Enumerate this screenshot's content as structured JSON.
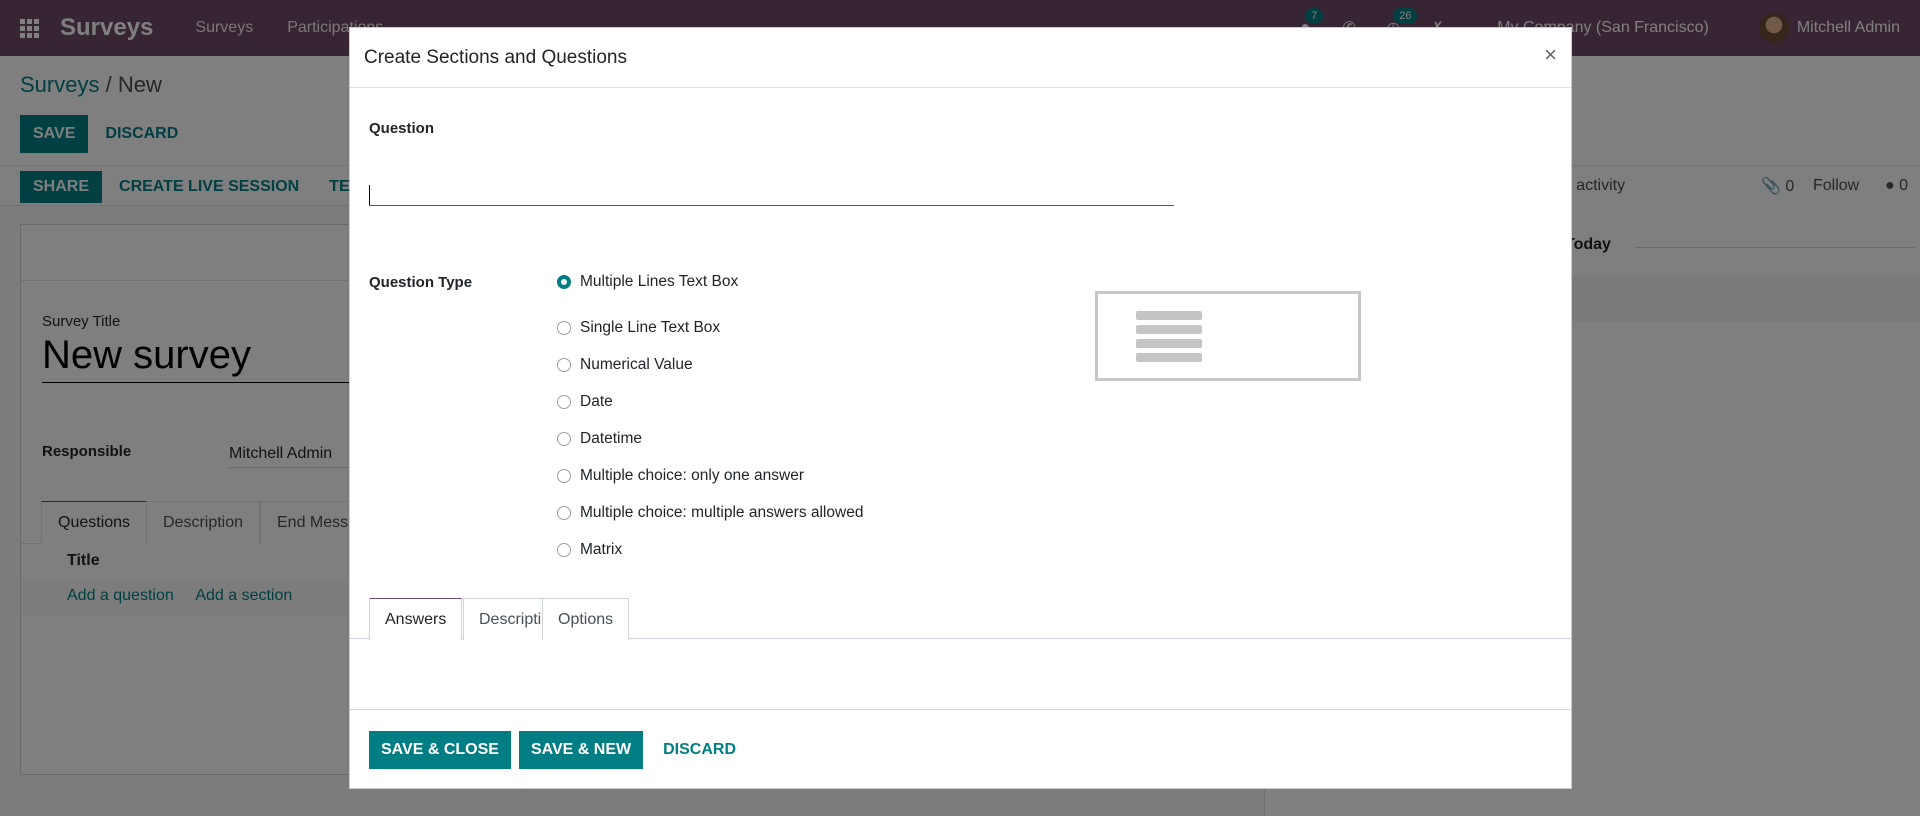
{
  "navbar": {
    "app_name": "Surveys",
    "menus": [
      "Surveys",
      "Participations"
    ],
    "messages_count": "7",
    "activities_count": "26",
    "company": "My Company (San Francisco)",
    "user": "Mitchell Admin"
  },
  "breadcrumb": {
    "parent": "Surveys",
    "separator": "/",
    "current": "New"
  },
  "control_panel": {
    "save": "Save",
    "discard": "Discard"
  },
  "statusbar": {
    "share": "Share",
    "create_live_session": "Create Live Session",
    "test": "Test"
  },
  "form": {
    "survey_title_label": "Survey Title",
    "survey_title_value": "New survey",
    "responsible_label": "Responsible",
    "responsible_value": "Mitchell Admin",
    "tabs": [
      "Questions",
      "Description",
      "End Message"
    ],
    "table_header_title": "Title",
    "add_question": "Add a question",
    "add_section": "Add a section"
  },
  "chatter": {
    "schedule_activity": "Schedule activity",
    "attachments_count": "0",
    "follow": "Follow",
    "followers_count": "0",
    "today": "Today"
  },
  "modal": {
    "title": "Create Sections and Questions",
    "close": "×",
    "question_label": "Question",
    "question_value": "",
    "question_type_label": "Question Type",
    "question_types": [
      "Multiple Lines Text Box",
      "Single Line Text Box",
      "Numerical Value",
      "Date",
      "Datetime",
      "Multiple choice: only one answer",
      "Multiple choice: multiple answers allowed",
      "Matrix"
    ],
    "selected_question_type": "Multiple Lines Text Box",
    "tabs": [
      "Answers",
      "Description",
      "Options"
    ],
    "active_tab": "Answers",
    "footer": {
      "save_close": "Save & Close",
      "save_new": "Save & New",
      "discard": "Discard"
    }
  },
  "colors": {
    "brand": "#714b67",
    "primary": "#017e84",
    "backdrop": "rgba(0,0,0,0.5)"
  }
}
